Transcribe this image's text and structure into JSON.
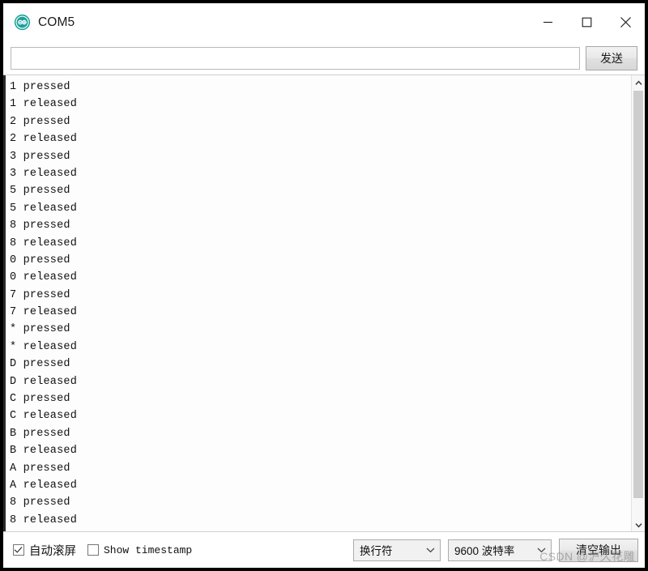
{
  "window": {
    "title": "COM5",
    "app_icon": "arduino-logo-icon",
    "accent_color": "#1aa09a",
    "controls": {
      "minimize": "minimize-icon",
      "maximize": "maximize-icon",
      "close": "close-icon"
    }
  },
  "send_bar": {
    "input_value": "",
    "input_placeholder": "",
    "send_label": "发送"
  },
  "console": {
    "lines": [
      "1 pressed",
      "1 released",
      "2 pressed",
      "2 released",
      "3 pressed",
      "3 released",
      "5 pressed",
      "5 released",
      "8 pressed",
      "8 released",
      "0 pressed",
      "0 released",
      "7 pressed",
      "7 released",
      "* pressed",
      "* released",
      "D pressed",
      "D released",
      "C pressed",
      "C released",
      "B pressed",
      "B released",
      "A pressed",
      "A released",
      "8 pressed",
      "8 released"
    ]
  },
  "scrollbar": {
    "up_icon": "chevron-up-icon",
    "down_icon": "chevron-down-icon"
  },
  "status_bar": {
    "autoscroll": {
      "label": "自动滚屏",
      "checked": true
    },
    "timestamp": {
      "label": "Show timestamp",
      "checked": false
    },
    "newline_select": {
      "value": "换行符",
      "arrow_icon": "chevron-down-icon"
    },
    "baud_select": {
      "value": "9600 波特率",
      "arrow_icon": "chevron-down-icon"
    },
    "clear_label": "清空输出"
  },
  "watermark": {
    "text": "CSDN @沪久花雕"
  }
}
